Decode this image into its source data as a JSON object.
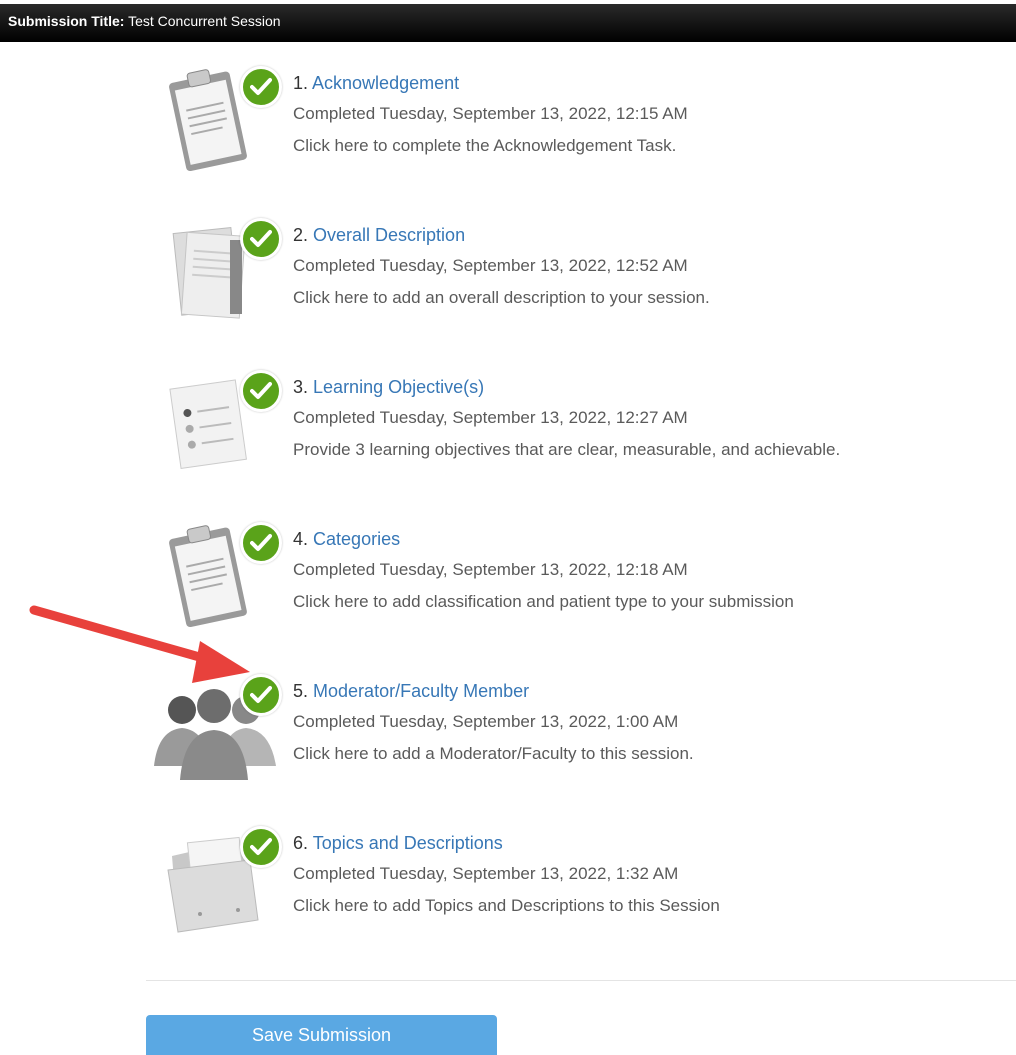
{
  "header": {
    "label": "Submission Title:",
    "value": "Test Concurrent Session"
  },
  "tasks": [
    {
      "number": "1.",
      "name": "Acknowledgement",
      "status": "Completed Tuesday, September 13, 2022, 12:15 AM",
      "description": "Click here to complete the Acknowledgement Task.",
      "icon": "clipboard-icon"
    },
    {
      "number": "2.",
      "name": "Overall Description",
      "status": "Completed Tuesday, September 13, 2022, 12:52 AM",
      "description": "Click here to add an overall description to your session.",
      "icon": "documents-icon"
    },
    {
      "number": "3.",
      "name": "Learning Objective(s)",
      "status": "Completed Tuesday, September 13, 2022, 12:27 AM",
      "description": "Provide 3 learning objectives that are clear, measurable, and achievable.",
      "icon": "checklist-icon"
    },
    {
      "number": "4.",
      "name": "Categories",
      "status": "Completed Tuesday, September 13, 2022, 12:18 AM",
      "description": "Click here to add classification and patient type to your submission",
      "icon": "clipboard-icon"
    },
    {
      "number": "5.",
      "name": "Moderator/Faculty Member",
      "status": "Completed Tuesday, September 13, 2022, 1:00 AM",
      "description": "Click here to add a Moderator/Faculty to this session.",
      "icon": "people-icon"
    },
    {
      "number": "6.",
      "name": "Topics and Descriptions",
      "status": "Completed Tuesday, September 13, 2022, 1:32 AM",
      "description": "Click here to add Topics and Descriptions to this Session",
      "icon": "folder-icon"
    }
  ],
  "actions": {
    "save_label": "Save Submission"
  },
  "colors": {
    "link": "#3777b6",
    "check": "#5aa31a",
    "button": "#5aa8e3",
    "arrow": "#e8413c"
  }
}
